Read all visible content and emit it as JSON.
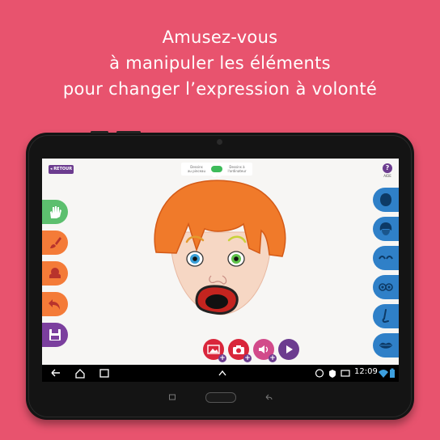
{
  "headline": {
    "line1": "Amusez-vous",
    "line2": "à manipuler les éléments",
    "line3": "pour changer l’expression à volonté"
  },
  "app": {
    "back_label": "◂ RETOUR",
    "help_label": "?",
    "help_caption": "AIDE",
    "mode_left_label_1": "Dessins",
    "mode_left_label_2": "au pinceau",
    "mode_right_label_1": "Dessins à",
    "mode_right_label_2": "l'ordinateur"
  },
  "left_toolbar": [
    {
      "icon": "hand-icon",
      "color": "#5cbf6e"
    },
    {
      "icon": "brush-icon",
      "color": "#f47b38"
    },
    {
      "icon": "stamp-icon",
      "color": "#f47b38"
    },
    {
      "icon": "undo-icon",
      "color": "#f47b38"
    },
    {
      "icon": "save-icon",
      "color": "#7b3f9e"
    }
  ],
  "right_toolbar": [
    {
      "icon": "head-shape-icon"
    },
    {
      "icon": "hair-icon"
    },
    {
      "icon": "eyebrows-icon"
    },
    {
      "icon": "eyes-icon"
    },
    {
      "icon": "nose-icon"
    },
    {
      "icon": "mouth-icon"
    }
  ],
  "bottom_toolbar": [
    {
      "icon": "image-add-icon",
      "color": "#d9263b"
    },
    {
      "icon": "camera-add-icon",
      "color": "#d9263b"
    },
    {
      "icon": "sound-add-icon",
      "color": "#d24a8a"
    },
    {
      "icon": "play-icon",
      "color": "#6c3c8f"
    }
  ],
  "statusbar": {
    "time": "12:09"
  },
  "colors": {
    "background": "#e8536e",
    "accent_purple": "#6c3c8f",
    "accent_blue": "#2f80c8",
    "accent_orange": "#f47b38",
    "accent_green": "#5cbf6e"
  }
}
